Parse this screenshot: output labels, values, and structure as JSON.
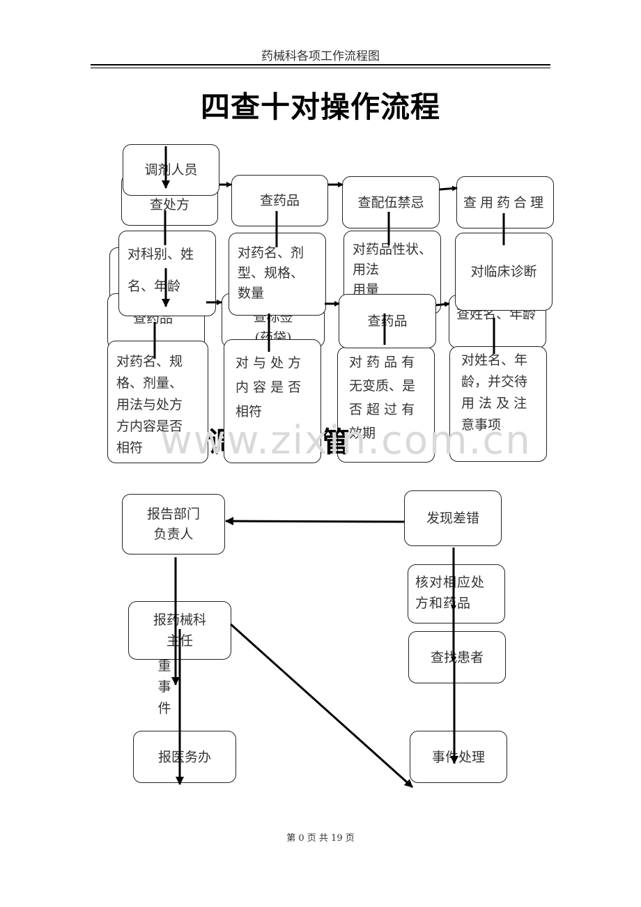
{
  "header": {
    "title": "药械科各项工作流程图"
  },
  "main_title": "四查十对操作流程",
  "section1": {
    "start": "调剂人员",
    "check_boxes": [
      {
        "label": "查处方"
      },
      {
        "label": "查药品"
      },
      {
        "label": "查配伍禁忌"
      },
      {
        "label": "查用药合理"
      }
    ],
    "verify_boxes": [
      {
        "label": "对科别、姓名、年龄",
        "lines": [
          "对科别、姓",
          "名、年龄"
        ]
      },
      {
        "label": "对药名、剂型、规格、数量",
        "lines": [
          "对药名、剂",
          "型、规格、",
          "数量"
        ]
      },
      {
        "label": "对药品性状、用法用量",
        "lines": [
          "对药品性状、",
          "用法",
          "用量"
        ]
      },
      {
        "label": "对临床诊断",
        "lines": [
          "对临床诊断"
        ]
      }
    ],
    "check_boxes_2": [
      {
        "label": "查药品"
      },
      {
        "label": "查标签(药袋)",
        "lines": [
          "查标签",
          "(药袋)"
        ]
      },
      {
        "label": "查药品"
      },
      {
        "label": "查姓名、年龄"
      }
    ],
    "verify_boxes_2": [
      {
        "label": "对药名、规格、剂量、用法与处方方内容是否相符",
        "lines": [
          "对药名、规",
          "格、剂量、",
          "用法与处方",
          "方内容是否",
          "相符"
        ]
      },
      {
        "label": "对与处方内容是否相符",
        "lines": [
          "对 与 处 方",
          "内 容 是 否",
          "相符"
        ]
      },
      {
        "label": "对药品有无变质、是否超过有效期",
        "lines": [
          "对 药 品 有",
          "无变质、是",
          "否 超 过 有",
          "效期"
        ]
      },
      {
        "label": "对姓名、年龄，并交待用法及注意事项",
        "lines": [
          "对姓名、年",
          "龄，并交待",
          "用 法 及 注",
          "意事项"
        ]
      }
    ]
  },
  "section2": {
    "heading_partial_left": "调",
    "heading_partial_right": "管",
    "boxes": {
      "report_dept_head": [
        "报告部门",
        "负责人"
      ],
      "found_error": "发现差错",
      "report_pharmacy_director": [
        "报药械科",
        "主任"
      ],
      "verify_rx_drug": [
        "核对相应处",
        "方和药品"
      ],
      "find_patient": "查找患者",
      "report_medical_office": "报医务办",
      "handle_incident": "事件处理"
    },
    "side_label_chars": [
      "重",
      "事",
      "件"
    ]
  },
  "watermark": "www.zixin.com.cn",
  "footer": {
    "page_text": "第 0 页 共 19 页"
  }
}
